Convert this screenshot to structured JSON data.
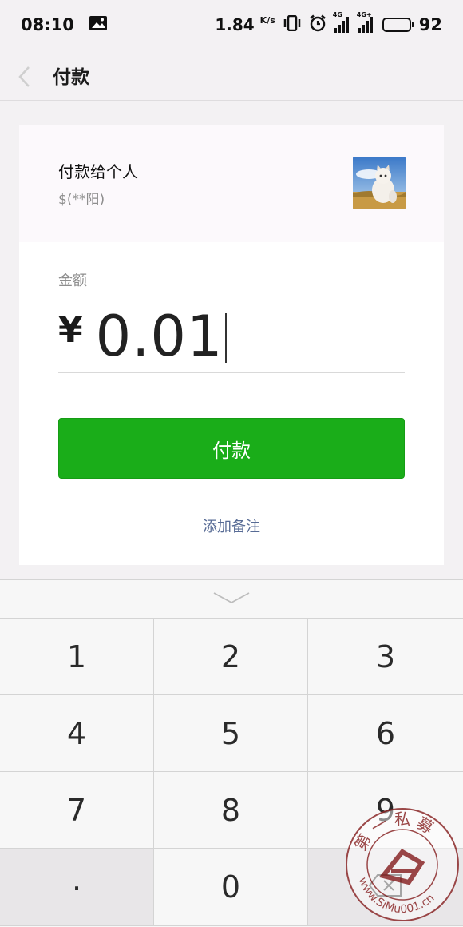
{
  "status_bar": {
    "time": "08:10",
    "net_speed": "1.84",
    "net_unit": "K/s",
    "signal_1_tag": "4G",
    "signal_2_tag": "4G+",
    "battery": "92"
  },
  "nav": {
    "title": "付款"
  },
  "payee": {
    "title": "付款给个人",
    "name": "$(**阳)"
  },
  "amount": {
    "label": "金额",
    "currency": "¥",
    "value": "0.01"
  },
  "pay_button_label": "付款",
  "add_note_label": "添加备注",
  "keypad": {
    "keys": [
      "1",
      "2",
      "3",
      "4",
      "5",
      "6",
      "7",
      "8",
      "9",
      ".",
      "0",
      ""
    ]
  },
  "watermark": {
    "text": "第一私募 www.SiMu001.cn"
  },
  "colors": {
    "accent_green": "#1aad19",
    "link_blue": "#576b95",
    "background": "#f3f1f3",
    "watermark_red": "#8c2a2a"
  }
}
